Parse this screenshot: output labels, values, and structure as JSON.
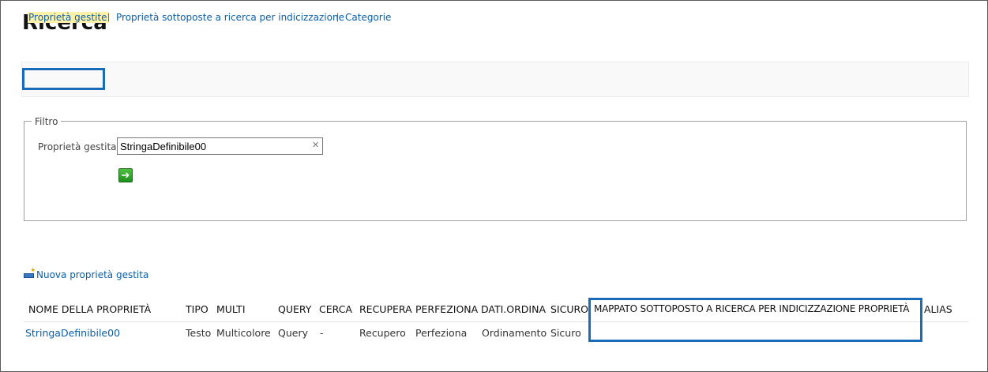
{
  "page": {
    "title": "Ricerca"
  },
  "nav": {
    "links": [
      {
        "label": "Proprietà gestite",
        "selected": true
      },
      {
        "label": "Proprietà sottoposte a ricerca per indicizzazione",
        "selected": false
      },
      {
        "label": "Categorie",
        "selected": false
      }
    ],
    "separator": "|"
  },
  "filter": {
    "legend": "Filtro",
    "label": "Proprietà gestita",
    "value": "StringaDefinibile00",
    "clear_icon": "close-icon",
    "go_icon": "arrow-right-icon"
  },
  "new_property": {
    "label": "Nuova proprietà gestita",
    "icon": "new-item-icon"
  },
  "table": {
    "columns": [
      "NOME DELLA PROPRIETÀ",
      "TIPO",
      "MULTI",
      "QUERY",
      "CERCA",
      "RECUPERA",
      "PERFEZIONA",
      "DATI.ORDINA",
      "SICURO",
      "MAPPATO SOTTOPOSTO A RICERCA PER INDICIZZAZIONE PROPRIETÀ",
      "ALIAS"
    ],
    "rows": [
      {
        "name": "StringaDefinibile00",
        "type": "Testo",
        "multi": "Multicolore",
        "query": "Query",
        "search": "-",
        "retrieve": "Recupero",
        "refine": "Perfeziona",
        "sort": "Ordinamento",
        "secure": "Sicuro",
        "mapped": "",
        "alias": ""
      }
    ]
  },
  "colors": {
    "link": "#0b5ea8",
    "highlight_box": "#1a6bb8",
    "go_button": "#2ea32e"
  }
}
